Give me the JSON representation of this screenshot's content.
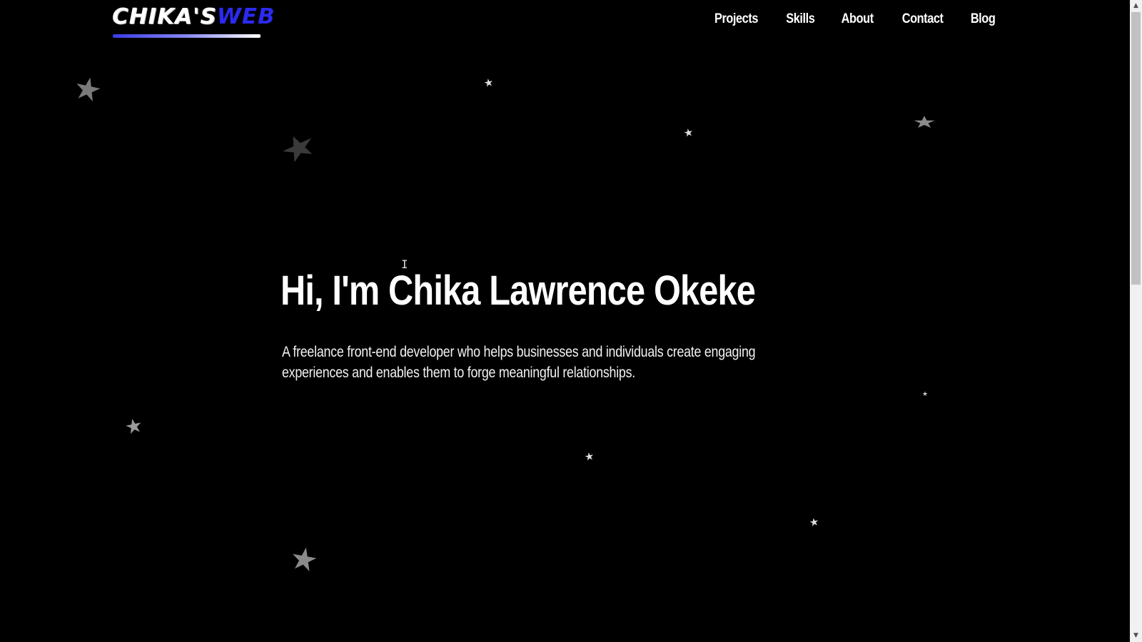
{
  "header": {
    "logo_main": "CHIKA'S",
    "logo_accent": "WEB",
    "nav": [
      {
        "label": "Projects"
      },
      {
        "label": "Skills"
      },
      {
        "label": "About"
      },
      {
        "label": "Contact"
      },
      {
        "label": "Blog"
      }
    ]
  },
  "hero": {
    "title": "Hi, I'm Chika Lawrence Okeke",
    "subtitle": "A freelance front-end developer who helps businesses and individuals create engaging experiences and enables them to forge meaningful relationships."
  },
  "colors": {
    "background": "#000000",
    "text": "#ffffff",
    "accent": "#2a2af0",
    "star": "#8a8a8a"
  },
  "icons": {
    "star": "star-icon",
    "cursor": "text-cursor-icon"
  }
}
